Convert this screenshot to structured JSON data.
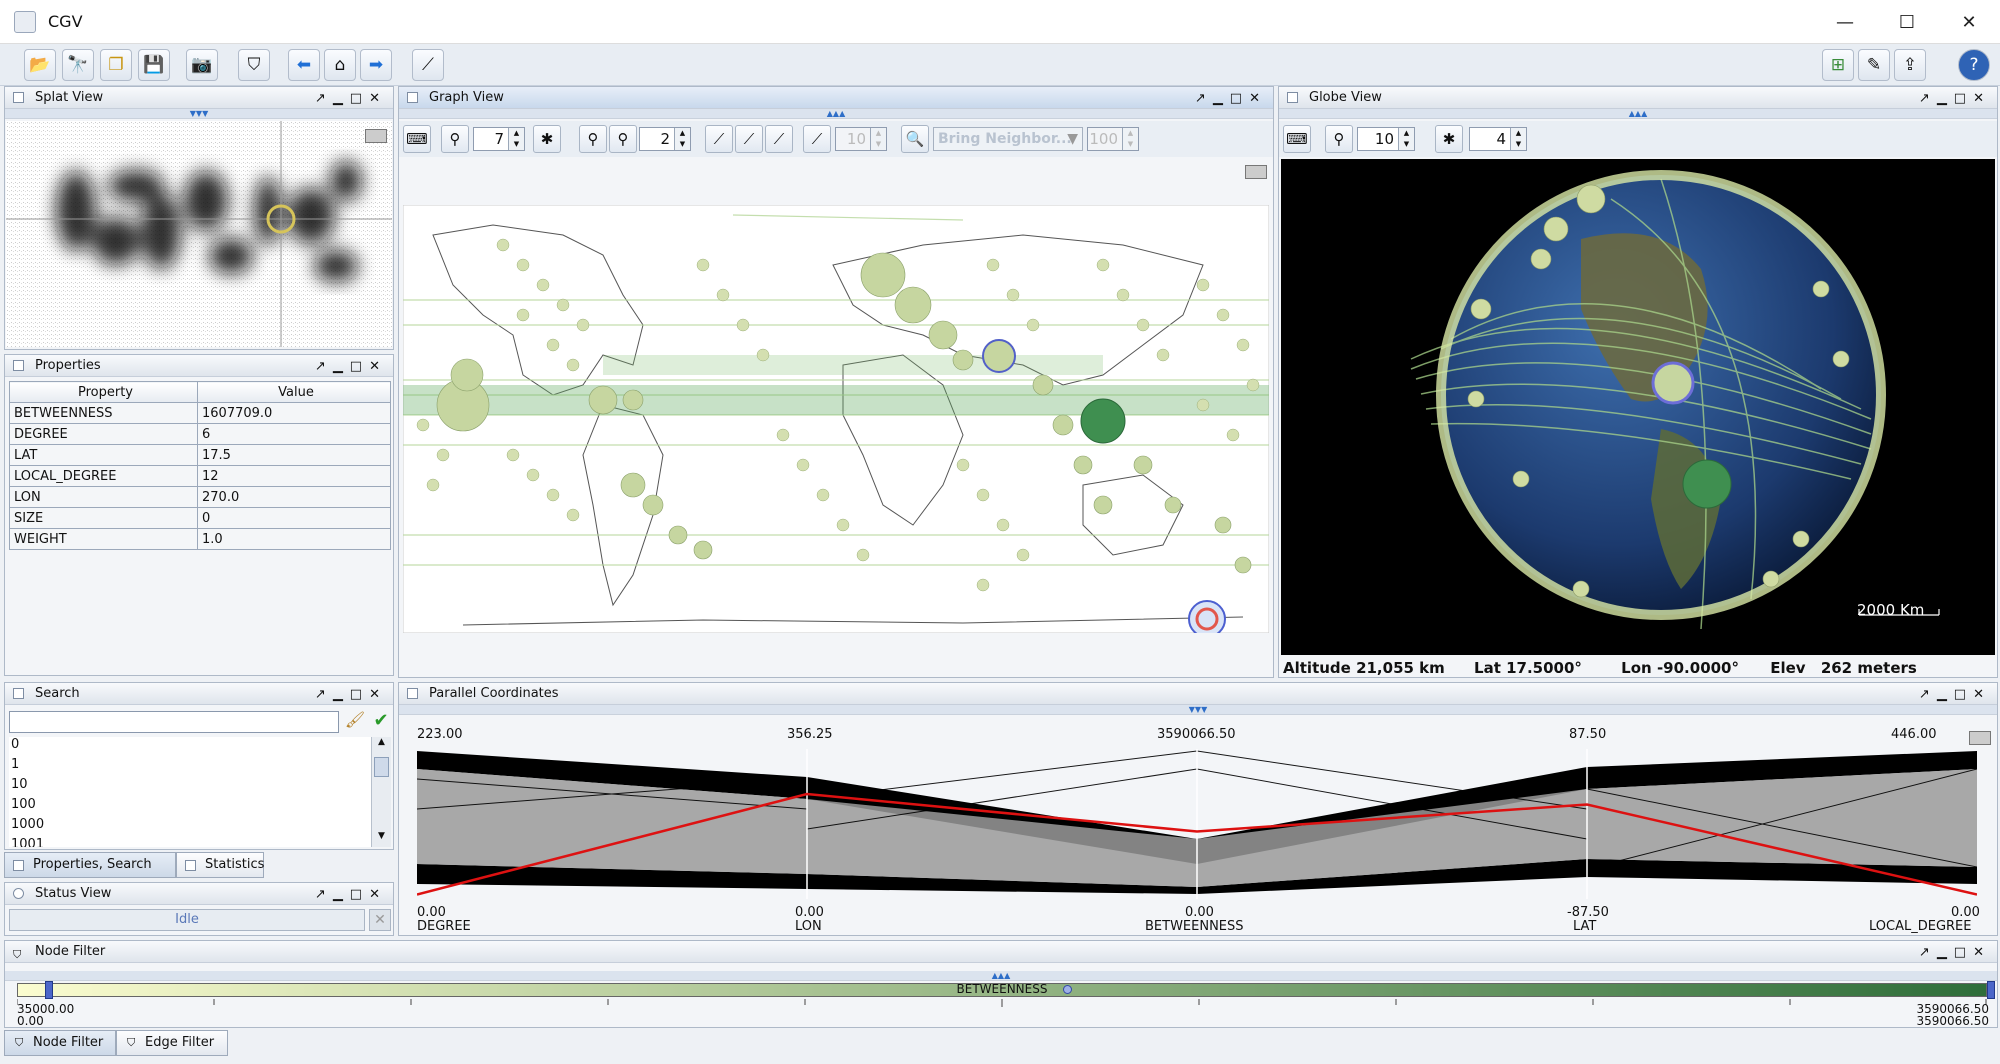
{
  "window": {
    "title": "CGV"
  },
  "toolbar": {
    "icons": [
      "open-folder-icon",
      "binoculars-icon",
      "duplicate-icon",
      "save-icon",
      "screenshot-icon",
      "filter-icon",
      "back-arrow-icon",
      "home-icon",
      "forward-arrow-icon",
      "graph-layout-icon"
    ],
    "right_icons": [
      "new-window-icon",
      "edit-window-icon",
      "export-icon",
      "help-icon"
    ]
  },
  "splat": {
    "title": "Splat View"
  },
  "properties": {
    "title": "Properties",
    "headers": [
      "Property",
      "Value"
    ],
    "rows": [
      {
        "p": "BETWEENNESS",
        "v": "1607709.0"
      },
      {
        "p": "DEGREE",
        "v": "6"
      },
      {
        "p": "LAT",
        "v": "17.5"
      },
      {
        "p": "LOCAL_DEGREE",
        "v": "12"
      },
      {
        "p": "LON",
        "v": "270.0"
      },
      {
        "p": "SIZE",
        "v": "0"
      },
      {
        "p": "WEIGHT",
        "v": "1.0"
      }
    ]
  },
  "search": {
    "title": "Search",
    "input": "",
    "items": [
      "0",
      "1",
      "10",
      "100",
      "1000",
      "1001"
    ]
  },
  "lefttabs": {
    "tab1": "Properties, Search",
    "tab2": "Statistics"
  },
  "status": {
    "title": "Status View",
    "text": "Idle"
  },
  "graph": {
    "title": "Graph View",
    "spin1": "7",
    "spin2": "2",
    "spin3": "10",
    "spin4": "100",
    "neighbor_select": "Bring Neighbor..."
  },
  "globe": {
    "title": "Globe View",
    "spin1": "10",
    "spin2": "4",
    "scale": "2000 Km",
    "altitude_label": "Altitude",
    "altitude": "21,055 km",
    "lat_label": "Lat",
    "lat": "17.5000°",
    "lon_label": "Lon",
    "lon": "-90.0000°",
    "elev_label": "Elev",
    "elev": "262 meters"
  },
  "parallel": {
    "title": "Parallel Coordinates",
    "axes": [
      {
        "name": "DEGREE",
        "max": "223.00",
        "min": "0.00"
      },
      {
        "name": "LON",
        "max": "356.25",
        "min": "0.00"
      },
      {
        "name": "BETWEENNESS",
        "max": "3590066.50",
        "min": "0.00"
      },
      {
        "name": "LAT",
        "max": "87.50",
        "min": "-87.50"
      },
      {
        "name": "LOCAL_DEGREE",
        "max": "446.00",
        "min": "0.00"
      }
    ],
    "highlight_fraction": [
      0.03,
      0.7,
      0.45,
      0.63,
      0.03
    ]
  },
  "nodefilter": {
    "title": "Node Filter",
    "attribute": "BETWEENNESS",
    "left_value": "35000.00",
    "left_min": "0.00",
    "right_value": "3590066.50",
    "right_min": "3590066.50",
    "colors": {
      "start": "#fbfccf",
      "end": "#2f6e3a"
    }
  },
  "bottomtabs": {
    "tab1": "Node Filter",
    "tab2": "Edge Filter"
  }
}
